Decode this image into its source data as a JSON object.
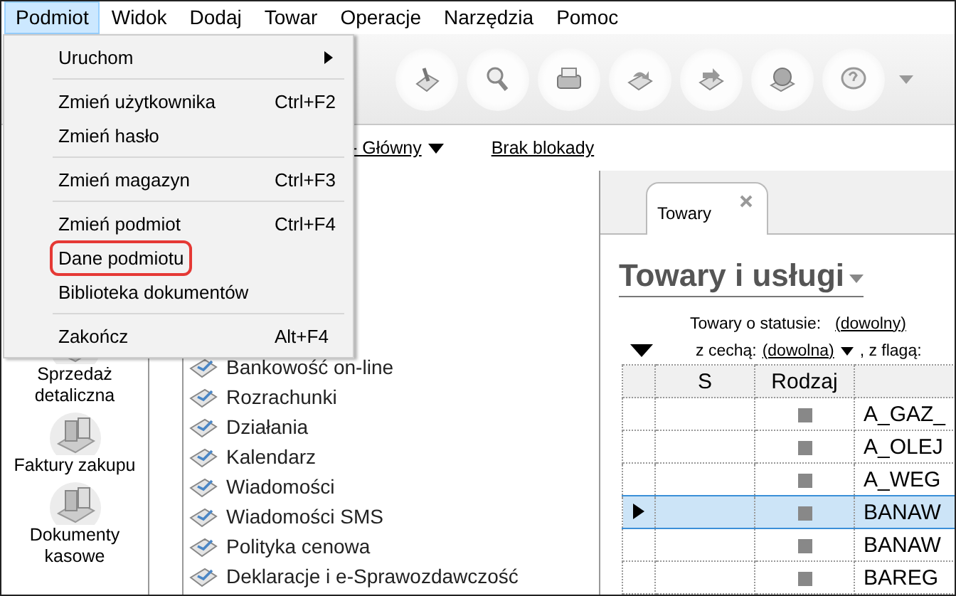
{
  "menubar": [
    {
      "label": "Podmiot",
      "selected": true
    },
    {
      "label": "Widok",
      "selected": false
    },
    {
      "label": "Dodaj",
      "selected": false
    },
    {
      "label": "Towar",
      "selected": false
    },
    {
      "label": "Operacje",
      "selected": false
    },
    {
      "label": "Narzędzia",
      "selected": false
    },
    {
      "label": "Pomoc",
      "selected": false
    }
  ],
  "menu": {
    "items": [
      {
        "kind": "item",
        "label": "Uruchom",
        "submenu": true,
        "highlighted": false
      },
      {
        "kind": "separator"
      },
      {
        "kind": "item",
        "label": "Zmień użytkownika",
        "shortcut": "Ctrl+F2",
        "submenu": false,
        "highlighted": false
      },
      {
        "kind": "item",
        "label": "Zmień hasło",
        "submenu": false,
        "highlighted": false
      },
      {
        "kind": "separator"
      },
      {
        "kind": "item",
        "label": "Zmień magazyn",
        "shortcut": "Ctrl+F3",
        "submenu": false,
        "highlighted": false
      },
      {
        "kind": "separator"
      },
      {
        "kind": "item",
        "label": "Zmień podmiot",
        "shortcut": "Ctrl+F4",
        "submenu": false,
        "highlighted": false
      },
      {
        "kind": "item",
        "label": "Dane podmiotu",
        "submenu": false,
        "highlighted": true
      },
      {
        "kind": "item",
        "label": "Biblioteka dokumentów",
        "submenu": false,
        "highlighted": false
      },
      {
        "kind": "separator"
      },
      {
        "kind": "item",
        "label": "Zakończ",
        "shortcut": "Alt+F4",
        "submenu": false,
        "highlighted": false
      }
    ]
  },
  "location_bar": {
    "warehouse": "- Główny",
    "lock": "Brak blokady"
  },
  "sidebar": {
    "items": [
      {
        "label": "Sprzedaż detaliczna"
      },
      {
        "label": "Faktury zakupu"
      },
      {
        "label": "Dokumenty kasowe"
      }
    ]
  },
  "nav_list": {
    "items": [
      "Bankowość on-line",
      "Rozrachunki",
      "Działania",
      "Kalendarz",
      "Wiadomości",
      "Wiadomości SMS",
      "Polityka cenowa",
      "Deklaracje i e-Sprawozdawczość"
    ]
  },
  "tabs": [
    {
      "label": "Towary",
      "selected": true
    }
  ],
  "panel": {
    "title": "Towary i usługi",
    "status_filter": {
      "label": "Towary o statusie:",
      "value": "(dowolny)"
    },
    "feature_filter": {
      "label": "z cechą:",
      "value": "(dowolna)",
      "suffix": ", z flagą:"
    }
  },
  "table": {
    "columns": [
      "S",
      "Rodzaj"
    ],
    "rows": [
      {
        "column_4": "A_GAZ_",
        "selected": false
      },
      {
        "column_4": "A_OLEJ",
        "selected": false
      },
      {
        "column_4": "A_WEG",
        "selected": false
      },
      {
        "column_4": "BANAW",
        "selected": true
      },
      {
        "column_4": "BANAW",
        "selected": false
      },
      {
        "column_4": "BAREG",
        "selected": false
      }
    ]
  }
}
